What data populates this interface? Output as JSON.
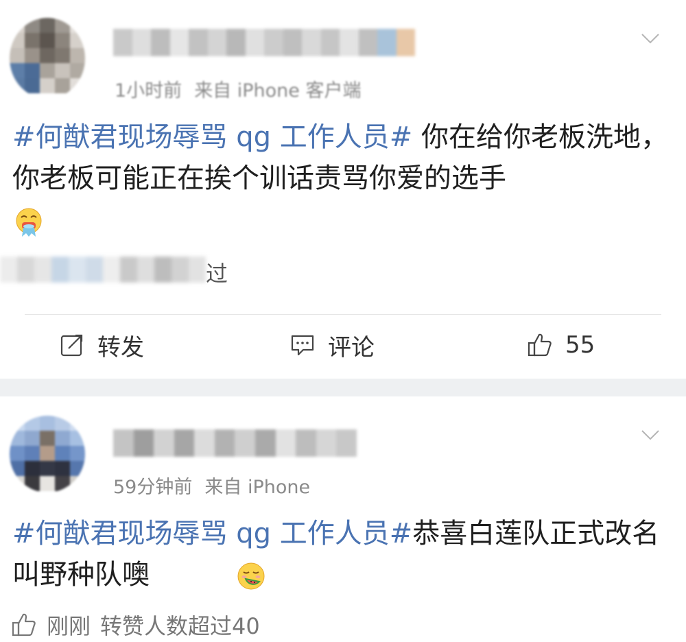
{
  "posts": [
    {
      "time": "1小时前",
      "source": "来自 iPhone 客户端",
      "hashtag": "#何猷君现场辱骂 qg 工作人员#",
      "text": " 你在给你老板洗地，你老板可能正在挨个训话责骂你爱的选手",
      "emoji_icon": "vomit-face-emoji",
      "liked_tail": "过",
      "actions": {
        "repost_label": "转发",
        "comment_label": "评论",
        "like_count": "55"
      }
    },
    {
      "time": "59分钟前",
      "source": "来自 iPhone",
      "hashtag": "#何猷君现场辱骂 qg 工作人员#",
      "text": "恭喜白莲队正式改名叫野种队噢",
      "emoji_icon": "eating-watermelon-emoji",
      "like_summary": {
        "time_label": "刚刚",
        "text": "转赞人数超过40"
      }
    }
  ],
  "colors": {
    "hashtag": "#4a73b2",
    "meta": "#8a8a8a",
    "separator": "#eef0f2"
  }
}
